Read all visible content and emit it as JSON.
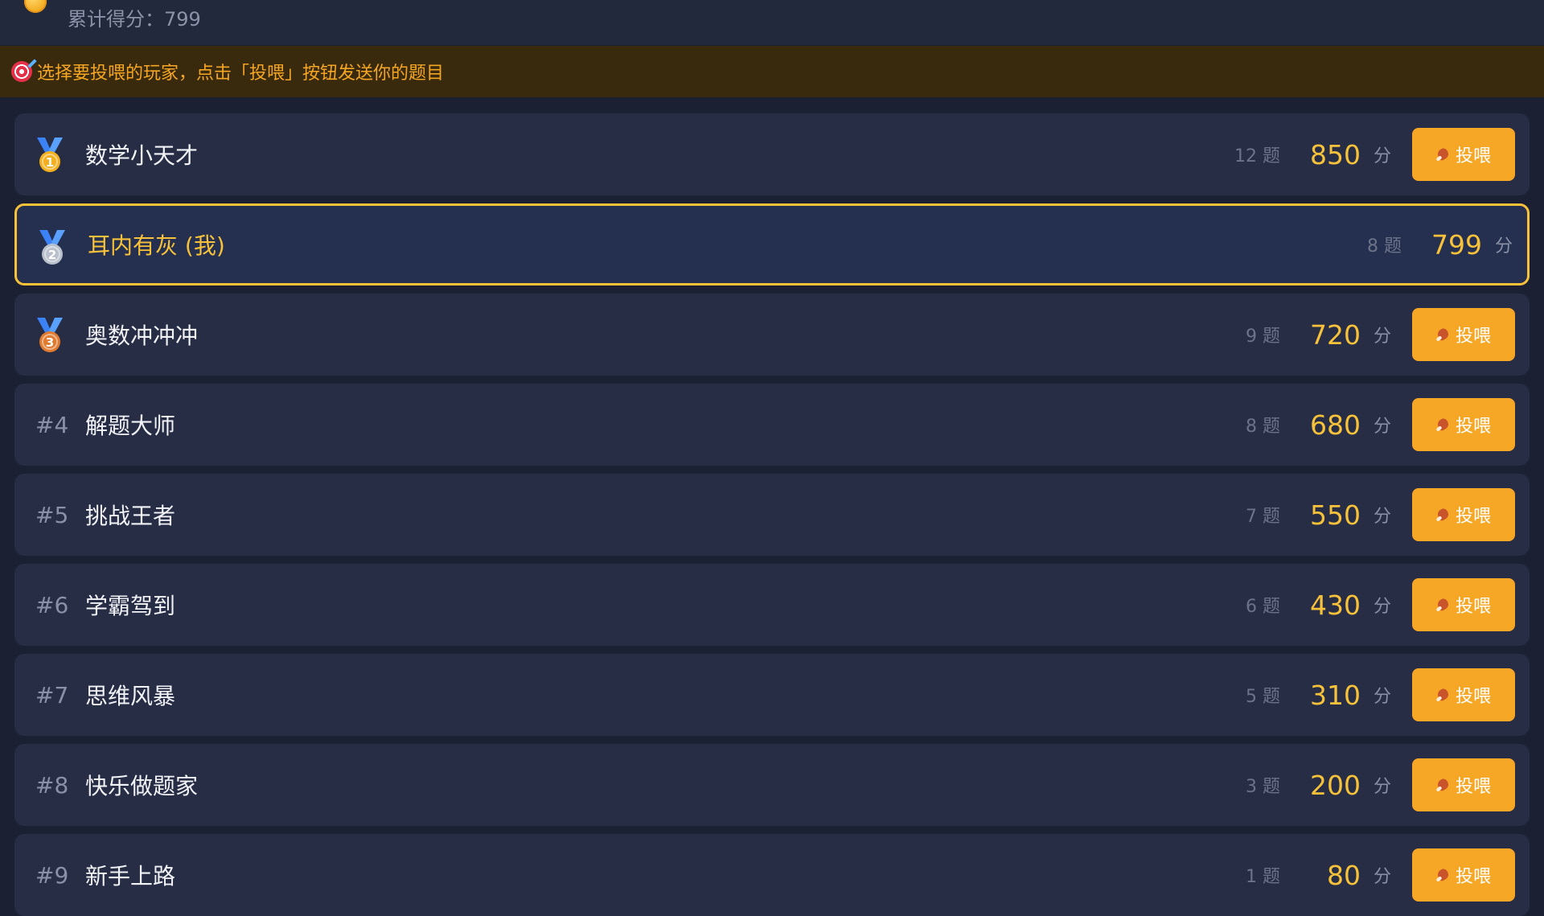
{
  "header": {
    "coin_icon": "gold-coin-icon",
    "score_text": "累计得分：799"
  },
  "tip": {
    "icon": "target-icon",
    "text": "选择要投喂的玩家，点击「投喂」按钮发送你的题目"
  },
  "feed_button_label": "投喂",
  "players": [
    {
      "rank_label": "",
      "medal": "gold-medal-icon",
      "name": "数学小天才",
      "questions": "12 题",
      "score": "850",
      "unit": "分",
      "is_me": false
    },
    {
      "rank_label": "",
      "medal": "silver-medal-icon",
      "name": "耳内有灰 (我)",
      "questions": "8 题",
      "score": "799",
      "unit": "分",
      "is_me": true
    },
    {
      "rank_label": "",
      "medal": "bronze-medal-icon",
      "name": "奥数冲冲冲",
      "questions": "9 题",
      "score": "720",
      "unit": "分",
      "is_me": false
    },
    {
      "rank_label": "#4",
      "medal": "",
      "name": "解题大师",
      "questions": "8 题",
      "score": "680",
      "unit": "分",
      "is_me": false
    },
    {
      "rank_label": "#5",
      "medal": "",
      "name": "挑战王者",
      "questions": "7 题",
      "score": "550",
      "unit": "分",
      "is_me": false
    },
    {
      "rank_label": "#6",
      "medal": "",
      "name": "学霸驾到",
      "questions": "6 题",
      "score": "430",
      "unit": "分",
      "is_me": false
    },
    {
      "rank_label": "#7",
      "medal": "",
      "name": "思维风暴",
      "questions": "5 题",
      "score": "310",
      "unit": "分",
      "is_me": false
    },
    {
      "rank_label": "#8",
      "medal": "",
      "name": "快乐做题家",
      "questions": "3 题",
      "score": "200",
      "unit": "分",
      "is_me": false
    },
    {
      "rank_label": "#9",
      "medal": "",
      "name": "新手上路",
      "questions": "1 题",
      "score": "80",
      "unit": "分",
      "is_me": false
    }
  ],
  "colors": {
    "accent": "#f7c23a",
    "button": "#f7a726",
    "background": "#1b2033",
    "row": "#272d45",
    "gold": "#f2b01e",
    "silver": "#b9c0cc",
    "bronze": "#e07a2e",
    "ribbon": "#3b82f6"
  }
}
